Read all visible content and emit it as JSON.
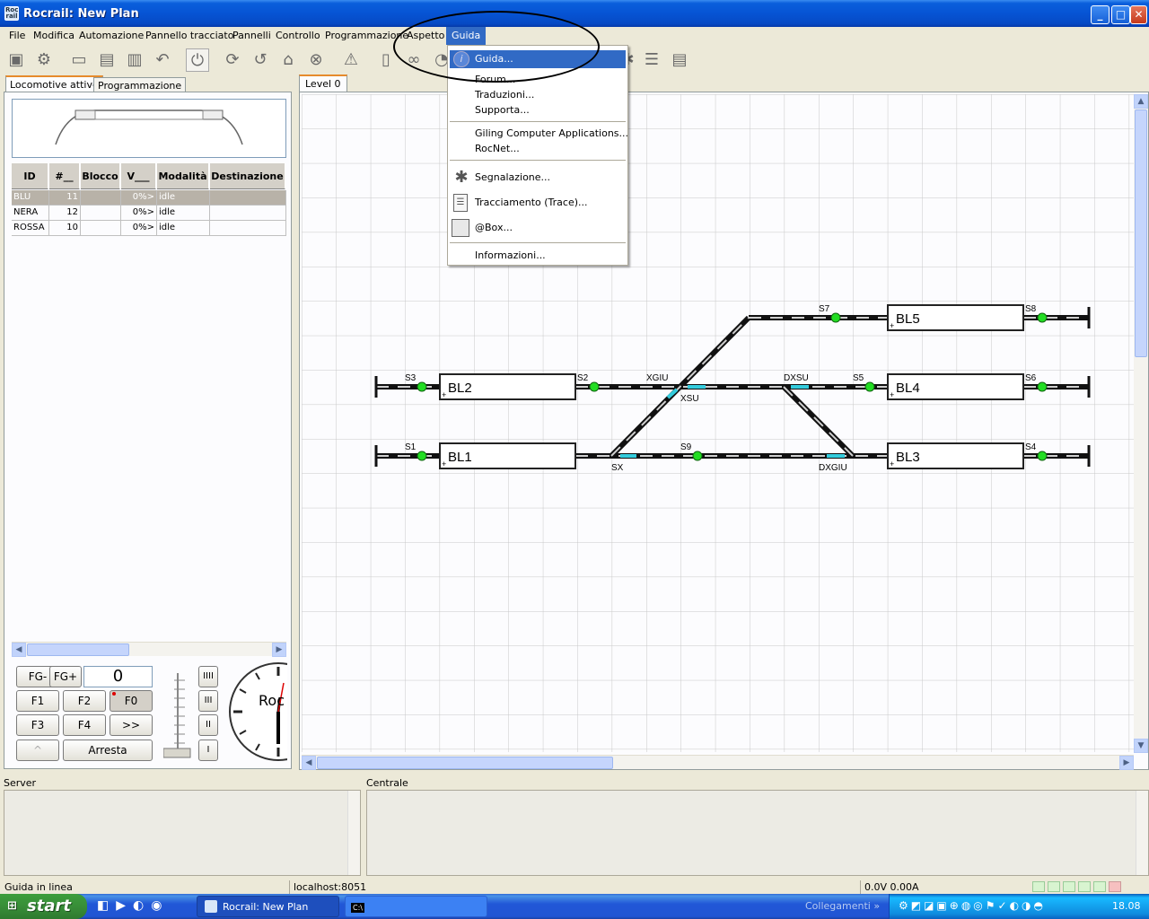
{
  "window": {
    "title": "Rocrail: New Plan",
    "app_icon_text": "Roc rail"
  },
  "menubar": [
    "File",
    "Modifica",
    "Automazione",
    "Pannello tracciato",
    "Pannelli",
    "Controllo",
    "Programmazione",
    "Aspetto",
    "Guida"
  ],
  "guida_menu": {
    "items": [
      {
        "label": "Guida...",
        "icon": "info-icon",
        "highlighted": true
      },
      {
        "label": "Forum..."
      },
      {
        "label": "Traduzioni..."
      },
      {
        "label": "Supporta..."
      },
      {
        "label": "Giling Computer Applications..."
      },
      {
        "label": "RocNet..."
      },
      {
        "label": "Segnalazione...",
        "icon": "bug-icon"
      },
      {
        "label": "Tracciamento (Trace)...",
        "icon": "trace-list-icon"
      },
      {
        "label": "@Box...",
        "icon": "box-icon"
      },
      {
        "label": "Informazioni..."
      }
    ]
  },
  "left_tabs": [
    "Locomotive attive",
    "Programmazione"
  ],
  "loco_table": {
    "headers": [
      "ID",
      "#__",
      "Blocco",
      "V___",
      "Modalità",
      "Destinazione"
    ],
    "rows": [
      [
        "BLU",
        "11",
        "",
        "0%>",
        "idle",
        ""
      ],
      [
        "NERA",
        "12",
        "",
        "0%>",
        "idle",
        ""
      ],
      [
        "ROSSA",
        "10",
        "",
        "0%>",
        "idle",
        ""
      ]
    ]
  },
  "throttle": {
    "fg_minus": "FG-",
    "fg_plus": "FG+",
    "speed": "0",
    "f1": "F1",
    "f2": "F2",
    "f0": "F0",
    "f3": "F3",
    "f4": "F4",
    "more": ">>",
    "dir": "^",
    "stop": "Arresta",
    "steps": [
      "IIII",
      "III",
      "II",
      "I"
    ],
    "clock_text": "Roc"
  },
  "plan": {
    "tab": "Level 0",
    "blocks": [
      "BL5",
      "BL2",
      "BL4",
      "BL1",
      "BL3"
    ],
    "signals": [
      "S7",
      "S8",
      "S3",
      "S2",
      "S5",
      "S6",
      "S1",
      "S9",
      "S4"
    ],
    "switches": [
      "XGIU",
      "XSU",
      "DXSU",
      "SX",
      "DXGIU"
    ]
  },
  "bottom": {
    "server_label": "Server",
    "centrale_label": "Centrale"
  },
  "status": {
    "text": "Guida in linea",
    "host": "localhost:8051",
    "power": "0.0V 0.00A"
  },
  "taskbar": {
    "start": "start",
    "task1": "Rocrail: New Plan",
    "task2": "C:\\",
    "links": "Collegamenti",
    "clock": "18.08"
  },
  "colors": {
    "menu_highlight": "#316ac5",
    "signal_green": "#22dd22",
    "switch_cyan": "#33ccdd",
    "tab_orange": "#e68b2c"
  }
}
